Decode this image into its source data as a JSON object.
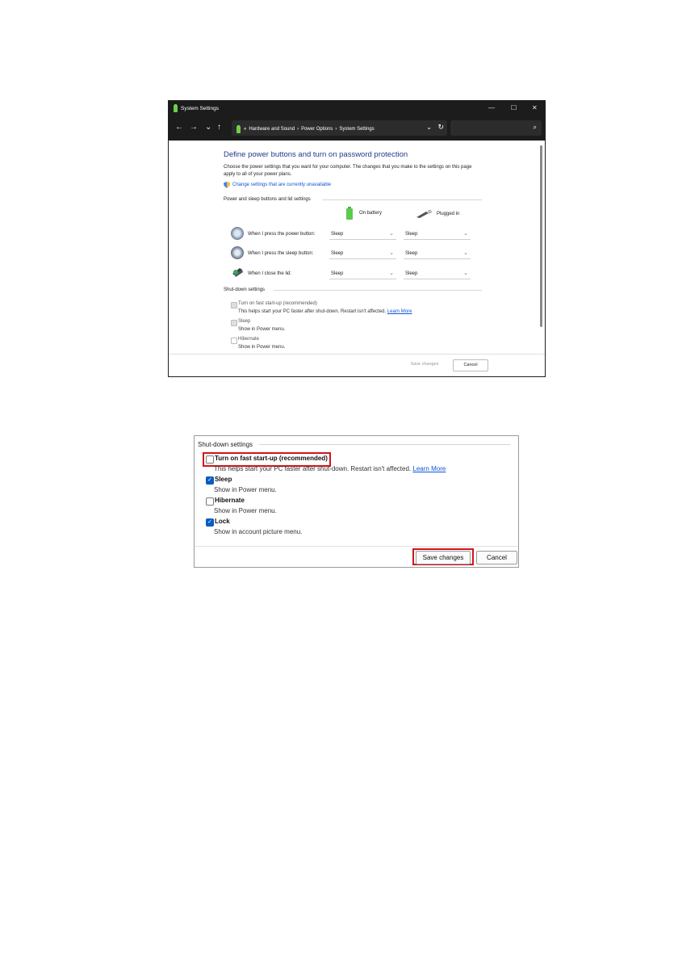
{
  "window": {
    "title": "System Settings",
    "controls": {
      "minimize": "—",
      "maximize": "☐",
      "close": "✕"
    }
  },
  "nav": {
    "back": "←",
    "forward": "→",
    "recent": "⌄",
    "up": "↑",
    "crumb_sep": "«",
    "breadcrumbs": [
      "Hardware and Sound",
      "Power Options",
      "System Settings"
    ],
    "arrow": "›",
    "dropdown": "⌄",
    "refresh": "↻",
    "search_icon": "⌕"
  },
  "page": {
    "title": "Define power buttons and turn on password protection",
    "description": "Choose the power settings that you want for your computer. The changes that you make to the settings on this page apply to all of your power plans.",
    "change_link": "Change settings that are currently unavailable",
    "section_power": "Power and sleep buttons and lid settings",
    "col_battery": "On battery",
    "col_plugged": "Plugged in",
    "rows": [
      {
        "label": "When I press the power button:",
        "battery": "Sleep",
        "plugged": "Sleep"
      },
      {
        "label": "When I press the sleep button:",
        "battery": "Sleep",
        "plugged": "Sleep"
      },
      {
        "label": "When I close the lid:",
        "battery": "Sleep",
        "plugged": "Sleep"
      }
    ],
    "chevron": "⌄",
    "section_shutdown": "Shut-down settings",
    "fast_startup": "Turn on fast start-up (recommended)",
    "fast_startup_desc": "This helps start your PC faster after shut-down. Restart isn't affected.",
    "learn_more": "Learn More",
    "sleep": "Sleep",
    "sleep_desc": "Show in Power menu.",
    "hibernate": "Hibernate",
    "hibernate_desc": "Show in Power menu.",
    "save": "Save changes",
    "cancel": "Cancel"
  },
  "detail": {
    "title": "Shut-down settings",
    "check": "✓",
    "fast_startup": "Turn on fast start-up (recommended)",
    "fast_startup_desc": "This helps start your PC faster after shut-down. Restart isn't affected.",
    "learn_more": "Learn More",
    "sleep": "Sleep",
    "sleep_desc": "Show in Power menu.",
    "hibernate": "Hibernate",
    "hibernate_desc": "Show in Power menu.",
    "lock": "Lock",
    "lock_desc": "Show in account picture menu.",
    "save": "Save changes",
    "cancel": "Cancel",
    "states": {
      "fast_startup": false,
      "sleep": true,
      "hibernate": false,
      "lock": true
    }
  },
  "colors": {
    "accent": "#0a5bc2",
    "highlight": "#d0151b",
    "title_blue": "#1e3a8a",
    "titlebar": "#1c1c1c"
  }
}
